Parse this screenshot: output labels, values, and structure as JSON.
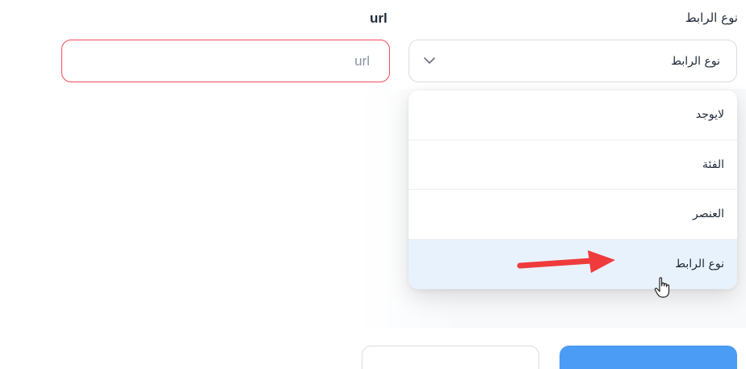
{
  "form": {
    "link_type_label": "نوع الرابط",
    "url_label": "url",
    "select": {
      "value": "نوع الرابط",
      "options": [
        {
          "label": "لايوجد",
          "selected": false
        },
        {
          "label": "الفئة",
          "selected": false
        },
        {
          "label": "العنصر",
          "selected": false
        },
        {
          "label": "نوع الرابط",
          "selected": true
        }
      ]
    },
    "url_input": {
      "placeholder": "url",
      "value": "",
      "border_color": "#ef4b5c"
    }
  },
  "buttons": {
    "primary_label": "",
    "secondary_label": ""
  },
  "colors": {
    "accent": "#4a9cf5",
    "highlight": "#e8f2fd",
    "annotation_arrow": "#ef3b3b"
  },
  "icons": {
    "select_chevron": "chevron-down-icon",
    "annotation": "red-arrow-icon",
    "cursor": "hand-pointer-icon"
  }
}
